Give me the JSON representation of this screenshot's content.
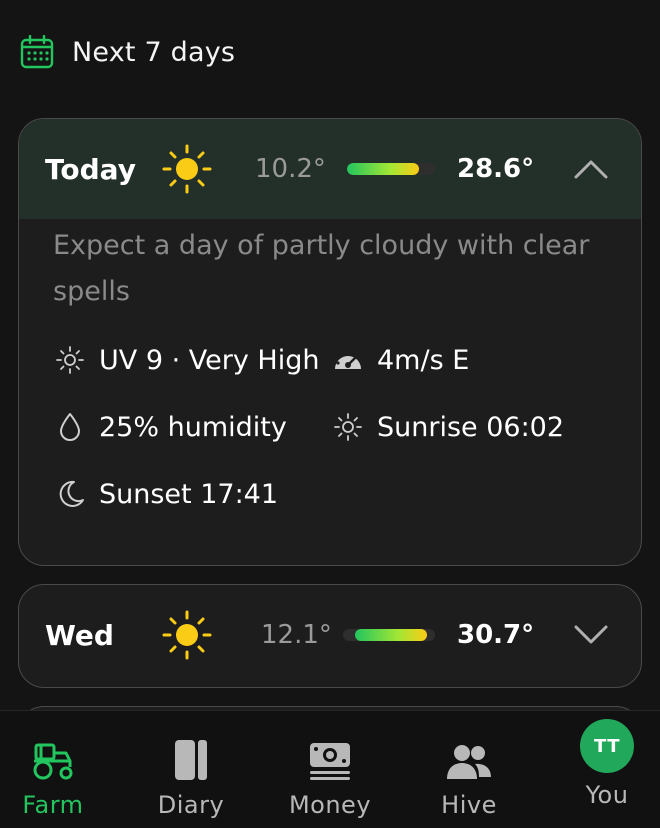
{
  "header": {
    "title": "Next 7 days",
    "icon": "calendar-icon"
  },
  "days": [
    {
      "name": "Today",
      "icon": "sun-icon",
      "min": "10.2°",
      "max": "28.6°",
      "expanded": true,
      "description": "Expect a day of partly cloudy with clear spells",
      "details": {
        "uv": "UV 9 · Very High",
        "wind": "4m/s E",
        "humidity": "25% humidity",
        "sunrise": "Sunrise 06:02",
        "sunset": "Sunset 17:41"
      }
    },
    {
      "name": "Wed",
      "icon": "sun-icon",
      "min": "12.1°",
      "max": "30.7°",
      "expanded": false
    }
  ],
  "nav": {
    "items": [
      {
        "label": "Farm",
        "icon": "tractor-icon",
        "active": true
      },
      {
        "label": "Diary",
        "icon": "diary-icon",
        "active": false
      },
      {
        "label": "Money",
        "icon": "money-icon",
        "active": false
      },
      {
        "label": "Hive",
        "icon": "people-icon",
        "active": false
      },
      {
        "label": "You",
        "icon": "avatar",
        "active": false
      }
    ],
    "avatar_initials": "TT"
  },
  "colors": {
    "accent": "#22c55e",
    "background": "#141414",
    "card": "#1d1d1d",
    "today_header": "#23302a",
    "sun": "#facc15"
  }
}
